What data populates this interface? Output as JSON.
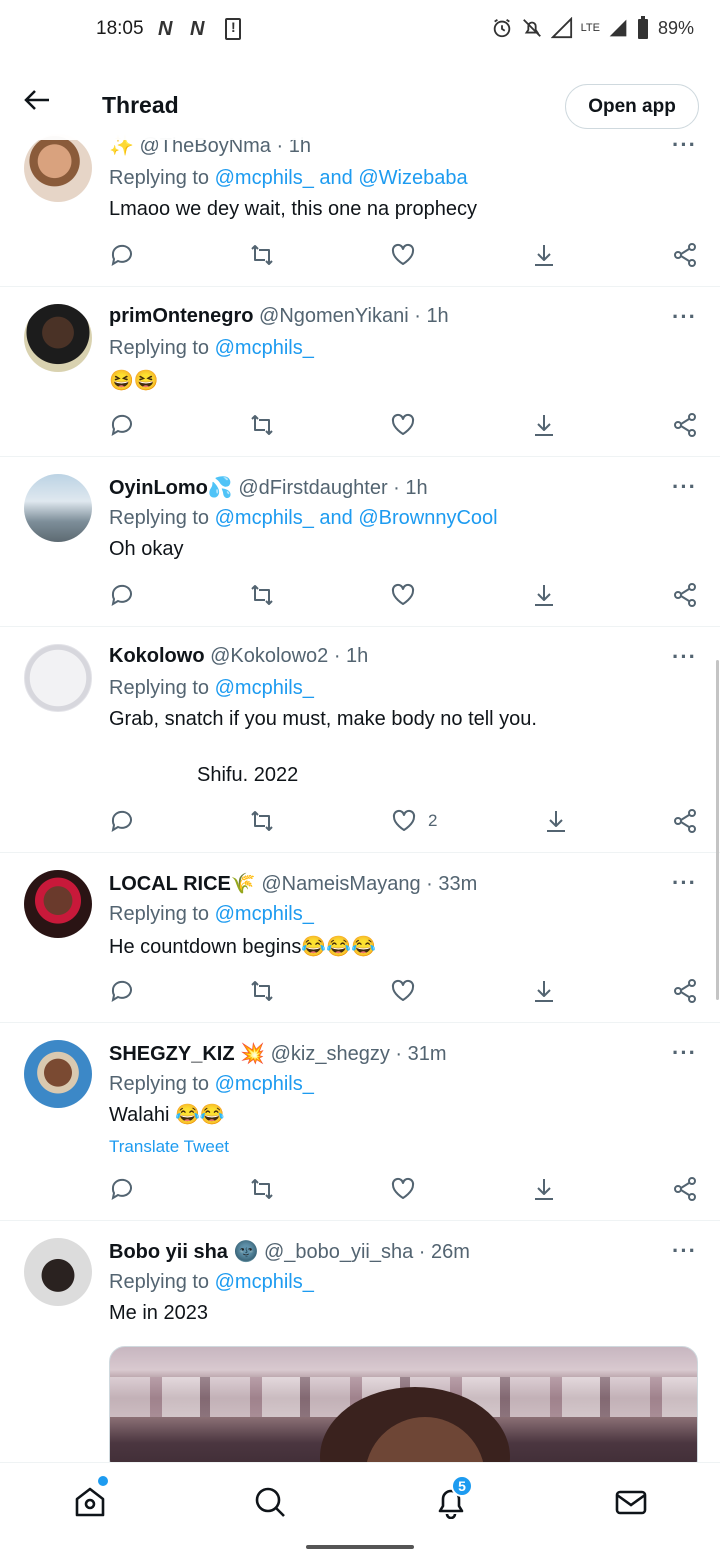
{
  "status_bar": {
    "time": "18:05",
    "notif_1": "N",
    "notif_2": "N",
    "network": "LTE",
    "battery": "89%"
  },
  "header": {
    "title": "Thread",
    "open_app_label": "Open app"
  },
  "tweets": [
    {
      "name": "",
      "handle": "@TheBoyNma",
      "time": "1h",
      "replying_prefix": "Replying to ",
      "replying_to": "@mcphils_ and @Wizebaba",
      "text": "Lmaoo we dey wait, this one na prophecy",
      "likes": ""
    },
    {
      "name": "primOntenegro",
      "handle": "@NgomenYikani",
      "time": "1h",
      "replying_prefix": "Replying to ",
      "replying_to": "@mcphils_",
      "text": "😆😆",
      "likes": ""
    },
    {
      "name": "OyinLomo💦",
      "handle": "@dFirstdaughter",
      "time": "1h",
      "replying_prefix": "Replying to ",
      "replying_to": "@mcphils_ and @BrownnyCool",
      "text": "Oh okay",
      "likes": ""
    },
    {
      "name": "Kokolowo",
      "handle": "@Kokolowo2",
      "time": "1h",
      "replying_prefix": "Replying to ",
      "replying_to": "@mcphils_",
      "text": "Grab, snatch if you must, make body no tell you.",
      "text2": "Shifu. 2022",
      "likes": "2"
    },
    {
      "name": "LOCAL RICE🌾",
      "handle": "@NameisMayang",
      "time": "33m",
      "replying_prefix": "Replying to ",
      "replying_to": "@mcphils_",
      "text": "He countdown begins😂😂😂",
      "likes": ""
    },
    {
      "name": "SHEGZY_KIZ 💥",
      "handle": "@kiz_shegzy",
      "time": "31m",
      "replying_prefix": "Replying to ",
      "replying_to": "@mcphils_",
      "text": "Walahi 😂😂",
      "translate": "Translate Tweet",
      "likes": ""
    },
    {
      "name": "Bobo yii sha 🌚",
      "handle": "@_bobo_yii_sha",
      "time": "26m",
      "replying_prefix": "Replying to ",
      "replying_to": "@mcphils_",
      "text": "Me in 2023",
      "likes": ""
    }
  ],
  "bottom_nav": {
    "notifications_badge": "5",
    "icons": [
      "home-icon",
      "search-icon",
      "notifications-icon",
      "messages-icon"
    ]
  },
  "colors": {
    "accent": "#1d9bf0",
    "text": "#0f1419",
    "secondary": "#536471"
  }
}
